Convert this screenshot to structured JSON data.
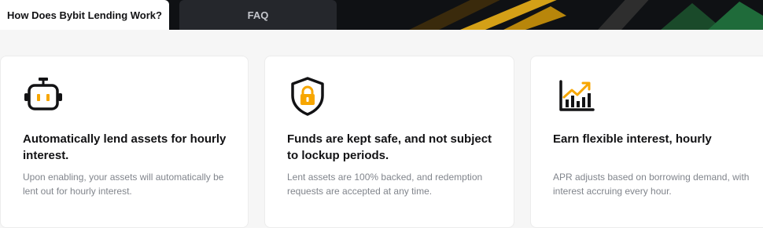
{
  "tabs": [
    {
      "label": "How Does Bybit Lending Work?",
      "active": true
    },
    {
      "label": "FAQ",
      "active": false
    }
  ],
  "features": [
    {
      "icon": "robot-icon",
      "title": "Automatically lend assets for hourly interest.",
      "description": "Upon enabling, your assets will automatically be lent out for hourly interest."
    },
    {
      "icon": "shield-lock-icon",
      "title": "Funds are kept safe, and not subject to lockup periods.",
      "description": "Lent assets are 100% backed, and redemption requests are accepted at any time."
    },
    {
      "icon": "growth-chart-icon",
      "title": "Earn flexible interest, hourly",
      "description": "APR adjusts based on borrowing demand, with interest accruing every hour."
    }
  ],
  "colors": {
    "accent": "#f7a600",
    "dark": "#121214",
    "topbar": "#0f1114"
  }
}
